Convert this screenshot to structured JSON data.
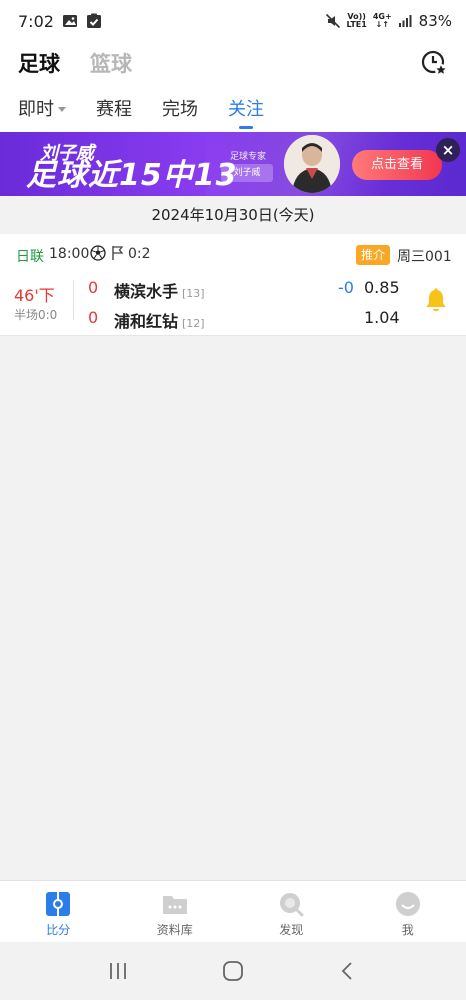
{
  "status_bar": {
    "time": "7:02",
    "battery": "83%",
    "vol_text": "Vo))",
    "lte_text": "LTE1",
    "net_text": "4G+"
  },
  "header": {
    "sports": [
      "足球",
      "篮球"
    ],
    "active_sport": "足球"
  },
  "subtabs": {
    "items": [
      "即时",
      "赛程",
      "完场",
      "关注"
    ],
    "active": "关注"
  },
  "banner": {
    "name": "刘子威",
    "headline": "足球近15中13",
    "role": "足球专家",
    "role_name": "刘子威",
    "cta": "点击查看",
    "close": "×"
  },
  "date": "2024年10月30日(今天)",
  "match": {
    "league": "日联",
    "time": "18:00",
    "corners": "0:2",
    "recommend_badge": "推介",
    "match_no": "周三001",
    "minute": "46'下",
    "half_score": "半场0:0",
    "home": {
      "score": "0",
      "name": "横滨水手",
      "rank": "[13]"
    },
    "away": {
      "score": "0",
      "name": "浦和红钻",
      "rank": "[12]"
    },
    "handicap": "-0",
    "odds_home": "0.85",
    "odds_away": "1.04"
  },
  "tabbar": {
    "items": [
      "比分",
      "资料库",
      "发现",
      "我"
    ],
    "active": "比分"
  },
  "colors": {
    "accent": "#2b7de9",
    "live_red": "#e53935",
    "league_green": "#1f9a3f",
    "badge_orange": "#f9a825",
    "bell_yellow": "#f7c21a",
    "banner_purple": "#7a34e0"
  },
  "icons": [
    "image-icon",
    "check-square-icon",
    "mute-icon",
    "signal-icon",
    "history-star-icon",
    "soccer-ball-icon",
    "corner-flag-icon",
    "bell-icon",
    "score-icon",
    "folder-icon",
    "discover-icon",
    "profile-icon",
    "recent-apps-icon",
    "home-icon",
    "back-icon"
  ]
}
